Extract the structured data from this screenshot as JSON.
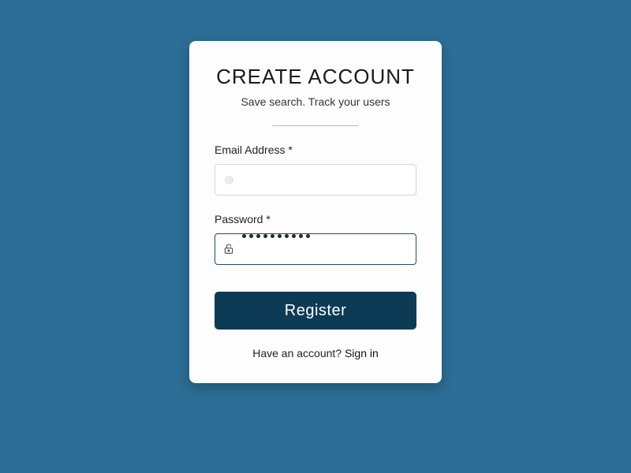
{
  "card": {
    "title": "CREATE ACCOUNT",
    "subtitle": "Save search. Track your users",
    "email": {
      "label": "Email Address *",
      "value": "",
      "placeholder": ""
    },
    "password": {
      "label": "Password *",
      "value": "••••••••••",
      "dot_count": 10
    },
    "register_label": "Register",
    "signin_prompt": "Have an account? ",
    "signin_link": "Sign in"
  },
  "colors": {
    "page_bg": "#2c6e96",
    "button_bg": "#0d3b55",
    "border_focus": "#1c4e6b"
  }
}
